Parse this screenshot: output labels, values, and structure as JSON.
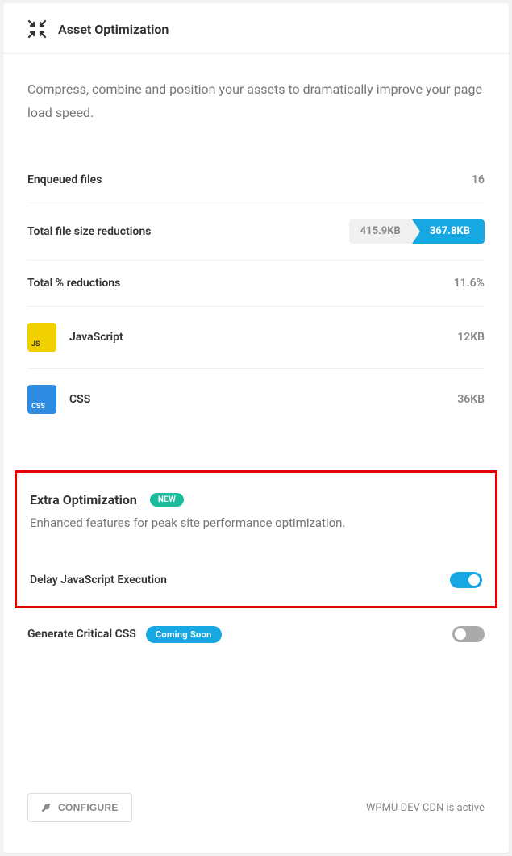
{
  "header": {
    "title": "Asset Optimization"
  },
  "description": "Compress, combine and position your assets to dramatically improve your page load speed.",
  "stats": {
    "enqueued": {
      "label": "Enqueued files",
      "value": "16"
    },
    "size_reduction": {
      "label": "Total file size reductions",
      "before": "415.9KB",
      "after": "367.8KB"
    },
    "percent_reduction": {
      "label": "Total % reductions",
      "value": "11.6%"
    }
  },
  "assets": {
    "js": {
      "badge": "JS",
      "name": "JavaScript",
      "size": "12KB"
    },
    "css": {
      "badge": "CSS",
      "name": "CSS",
      "size": "36KB"
    }
  },
  "extra": {
    "title": "Extra Optimization",
    "new_badge": "NEW",
    "description": "Enhanced features for peak site performance optimization.",
    "delay_js": {
      "label": "Delay JavaScript Execution"
    },
    "critical_css": {
      "label": "Generate Critical CSS",
      "coming_badge": "Coming Soon"
    }
  },
  "footer": {
    "configure_label": "CONFIGURE",
    "note": "WPMU DEV CDN is active"
  }
}
